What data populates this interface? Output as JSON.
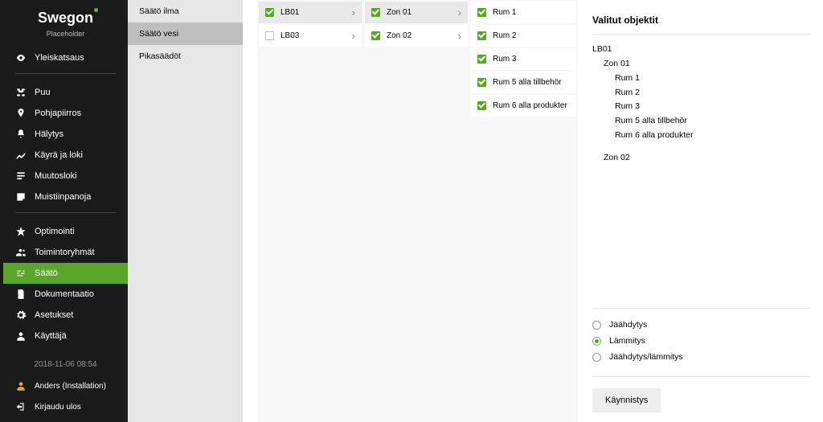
{
  "brand": {
    "name": "Swegon",
    "placeholder": "Placeholder"
  },
  "menu_top": {
    "yleiskatsaus": "Yleiskatsaus"
  },
  "menu_mid": {
    "puu": "Puu",
    "pohjapiirros": "Pohjapiirros",
    "halytys": "Hälytys",
    "kayra": "Käyrä ja loki",
    "muutosloki": "Muutosloki",
    "muistiinpanoja": "Muistiinpanoja"
  },
  "menu_bot": {
    "optimointi": "Optimointi",
    "toimintoryhmat": "Toimintoryhmät",
    "saato": "Säätö",
    "dokumentaatio": "Dokumentaatio",
    "asetukset": "Asetukset",
    "kayttaja": "Käyttäjä"
  },
  "timestamp": "2018-11-06 08:54",
  "user": "Anders (Installation)",
  "logout": "Kirjaudu ulos",
  "sub": {
    "ilma": "Säätö ilma",
    "vesi": "Säätö vesi",
    "pika": "Pikasäädöt"
  },
  "col1": {
    "lb01": "LB01",
    "lb03": "LB03"
  },
  "col2": {
    "z01": "Zon 01",
    "z02": "Zon 02"
  },
  "col3": {
    "r1": "Rum 1",
    "r2": "Rum 2",
    "r3": "Rum 3",
    "r5": "Rum 5 alla tillbehör",
    "r6": "Rum 6 alla produkter"
  },
  "right": {
    "title": "Valitut objektit",
    "tree": {
      "lb01": "LB01",
      "z01": "Zon 01",
      "r1": "Rum 1",
      "r2": "Rum 2",
      "r3": "Rum 3",
      "r5": "Rum 5 alla tillbehör",
      "r6": "Rum 6 alla produkter",
      "z02": "Zon 02"
    },
    "opts": {
      "cool": "Jäähdytys",
      "heat": "Lämmitys",
      "both": "Jäähdytys/lämmitys"
    },
    "start": "Käynnistys"
  }
}
